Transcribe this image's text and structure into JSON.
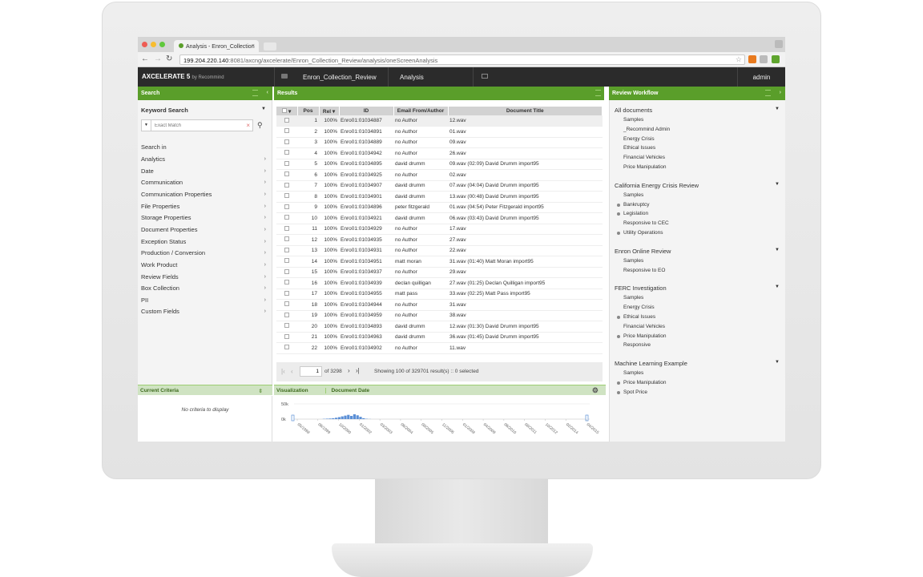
{
  "browser": {
    "tab_title": "Analysis - Enron_Collection",
    "url_host": "199.204.220.140",
    "url_path": ":8081/axcng/axcelerate/Enron_Collection_Review/analysis/oneScreenAnalysis"
  },
  "app": {
    "logo": "AXCELERATE 5",
    "logo_by": "by Recommind",
    "collection": "Enron_Collection_Review",
    "view": "Analysis",
    "user": "admin"
  },
  "panels": {
    "search": "Search",
    "results": "Results",
    "review_workflow": "Review Workflow",
    "current_criteria": "Current Criteria",
    "visualization": "Visualization",
    "document_date": "Document Date"
  },
  "search": {
    "keyword_label": "Keyword Search",
    "match_placeholder": "Exact Match",
    "search_in": "Search in",
    "facets": [
      "Analytics",
      "Date",
      "Communication",
      "Communication Properties",
      "File Properties",
      "Storage Properties",
      "Document Properties",
      "Exception Status",
      "Production / Conversion",
      "Work Product",
      "Review Fields",
      "Box Collection",
      "PII",
      "Custom Fields"
    ]
  },
  "results": {
    "columns": [
      "Pos",
      "Rel",
      "ID",
      "Email From/Author",
      "Document Title"
    ],
    "rows": [
      {
        "pos": "1",
        "rel": "100%",
        "id": "Enro01:01034887",
        "author": "no Author",
        "title": "12.wav"
      },
      {
        "pos": "2",
        "rel": "100%",
        "id": "Enro01:01034891",
        "author": "no Author",
        "title": "01.wav"
      },
      {
        "pos": "3",
        "rel": "100%",
        "id": "Enro01:01034889",
        "author": "no Author",
        "title": "09.wav"
      },
      {
        "pos": "4",
        "rel": "100%",
        "id": "Enro01:01034942",
        "author": "no Author",
        "title": "26.wav"
      },
      {
        "pos": "5",
        "rel": "100%",
        "id": "Enro01:01034895",
        "author": "david drumm",
        "title": "09.wav (02:09) David Drumm import95"
      },
      {
        "pos": "6",
        "rel": "100%",
        "id": "Enro01:01034925",
        "author": "no Author",
        "title": "02.wav"
      },
      {
        "pos": "7",
        "rel": "100%",
        "id": "Enro01:01034907",
        "author": "david drumm",
        "title": "07.wav (04:04) David Drumm import95"
      },
      {
        "pos": "8",
        "rel": "100%",
        "id": "Enro01:01034901",
        "author": "david drumm",
        "title": "13.wav (00:48) David Drumm import95"
      },
      {
        "pos": "9",
        "rel": "100%",
        "id": "Enro01:01034896",
        "author": "peter fitzgerald",
        "title": "01.wav (04:54) Peter Fitzgerald import95"
      },
      {
        "pos": "10",
        "rel": "100%",
        "id": "Enro01:01034921",
        "author": "david drumm",
        "title": "06.wav (03:43) David Drumm import95"
      },
      {
        "pos": "11",
        "rel": "100%",
        "id": "Enro01:01034929",
        "author": "no Author",
        "title": "17.wav"
      },
      {
        "pos": "12",
        "rel": "100%",
        "id": "Enro01:01034935",
        "author": "no Author",
        "title": "27.wav"
      },
      {
        "pos": "13",
        "rel": "100%",
        "id": "Enro01:01034931",
        "author": "no Author",
        "title": "22.wav"
      },
      {
        "pos": "14",
        "rel": "100%",
        "id": "Enro01:01034951",
        "author": "matt moran",
        "title": "31.wav (01:40) Matt Moran import95"
      },
      {
        "pos": "15",
        "rel": "100%",
        "id": "Enro01:01034937",
        "author": "no Author",
        "title": "29.wav"
      },
      {
        "pos": "16",
        "rel": "100%",
        "id": "Enro01:01034939",
        "author": "declan quilligan",
        "title": "27.wav (01:25) Declan Quilligan import95"
      },
      {
        "pos": "17",
        "rel": "100%",
        "id": "Enro01:01034955",
        "author": "matt pass",
        "title": "33.wav (02:25) Matt Pass import95"
      },
      {
        "pos": "18",
        "rel": "100%",
        "id": "Enro01:01034944",
        "author": "no Author",
        "title": "31.wav"
      },
      {
        "pos": "19",
        "rel": "100%",
        "id": "Enro01:01034959",
        "author": "no Author",
        "title": "38.wav"
      },
      {
        "pos": "20",
        "rel": "100%",
        "id": "Enro01:01034893",
        "author": "david drumm",
        "title": "12.wav (01:30) David Drumm import95"
      },
      {
        "pos": "21",
        "rel": "100%",
        "id": "Enro01:01034963",
        "author": "david drumm",
        "title": "36.wav (01:45) David Drumm import95"
      },
      {
        "pos": "22",
        "rel": "100%",
        "id": "Enro01:01034902",
        "author": "no Author",
        "title": "11.wav"
      }
    ],
    "page": "1",
    "page_of": "of 3298",
    "summary": "Showing 100 of 329701 result(s) :: 0 selected"
  },
  "workflow": [
    {
      "name": "All documents",
      "items": [
        {
          "label": "Samples",
          "dot": false
        },
        {
          "label": "_Recommind Admin",
          "dot": false
        },
        {
          "label": "Energy Crisis",
          "dot": false
        },
        {
          "label": "Ethical Issues",
          "dot": false
        },
        {
          "label": "Financial Vehicles",
          "dot": false
        },
        {
          "label": "Price Manipulation",
          "dot": false
        }
      ]
    },
    {
      "name": "California Energy Crisis Review",
      "items": [
        {
          "label": "Samples",
          "dot": false
        },
        {
          "label": "Bankruptcy",
          "dot": true
        },
        {
          "label": "Legislation",
          "dot": true
        },
        {
          "label": "Responsive to CEC",
          "dot": false
        },
        {
          "label": "Utility Operations",
          "dot": true
        }
      ]
    },
    {
      "name": "Enron Online Review",
      "items": [
        {
          "label": "Samples",
          "dot": false
        },
        {
          "label": "Responsive to EO",
          "dot": false
        }
      ]
    },
    {
      "name": "FERC Investigation",
      "items": [
        {
          "label": "Samples",
          "dot": false
        },
        {
          "label": "Energy Crisis",
          "dot": false
        },
        {
          "label": "Ethical Issues",
          "dot": true
        },
        {
          "label": "Financial Vehicles",
          "dot": false
        },
        {
          "label": "Price Manipulation",
          "dot": true
        },
        {
          "label": "Responsive",
          "dot": false
        }
      ]
    },
    {
      "name": "Machine Learning Example",
      "items": [
        {
          "label": "Samples",
          "dot": false
        },
        {
          "label": "Price Manipulation",
          "dot": true
        },
        {
          "label": "Spot Price",
          "dot": true
        }
      ]
    }
  ],
  "criteria": {
    "empty_text": "No criteria to display"
  },
  "chart_data": {
    "type": "bar",
    "title": "",
    "ytick_labels": [
      "50k",
      "0k"
    ],
    "ylim": [
      0,
      50000
    ],
    "categories": [
      "05/1998",
      "06/1999",
      "10/2000",
      "01/2002",
      "03/2003",
      "06/2004",
      "08/2005",
      "11/2006",
      "01/2008",
      "04/2009",
      "06/2010",
      "08/2011",
      "10/2012",
      "02/2014",
      "04/2015"
    ],
    "values": [
      0,
      800,
      1500,
      2000,
      3000,
      4500,
      6500,
      9000,
      11500,
      14000,
      10500,
      16000,
      12500,
      7500,
      3000,
      1000,
      400
    ]
  },
  "colors": {
    "accent_green": "#5a9e2a",
    "header_dark": "#2b2b2b",
    "bar_blue": "#5b8fd6"
  }
}
